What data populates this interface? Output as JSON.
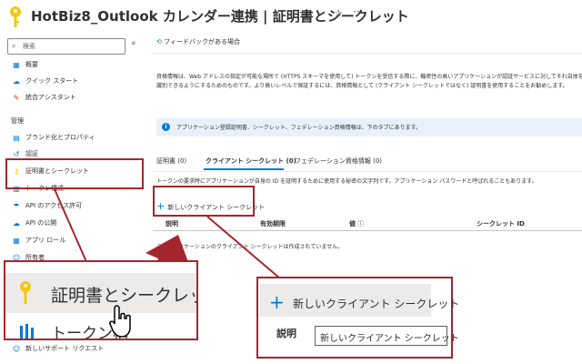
{
  "header": {
    "title": "HotBiz8_Outlook カレンダー連携 | 証明書とシークレット",
    "pin_icon": "✰",
    "more_icon": "···"
  },
  "sidebar": {
    "search_placeholder": "検索",
    "collapse_icon": "«",
    "items": [
      {
        "label": "概要",
        "icon": "▦"
      },
      {
        "label": "クイック スタート",
        "icon": "☁"
      },
      {
        "label": "統合アシスタント",
        "icon": "✎"
      }
    ],
    "section_label": "管理",
    "manage_items": [
      {
        "label": "ブランド化とプロパティ",
        "icon": "▤"
      },
      {
        "label": "認証",
        "icon": "↺"
      },
      {
        "label": "証明書とシークレット",
        "icon": "⚷"
      },
      {
        "label": "トークン構成",
        "icon": "▥"
      },
      {
        "label": "API のアクセス許可",
        "icon": "☂"
      },
      {
        "label": "API の公開",
        "icon": "☁"
      },
      {
        "label": "アプリ ロール",
        "icon": "▦"
      },
      {
        "label": "所有者",
        "icon": "☺"
      }
    ],
    "bottom_item": {
      "label": "新しいサポート リクエスト",
      "icon": "☺"
    }
  },
  "main": {
    "feedback_label": "フィードバックがある場合",
    "description_line1": "資格情報は、Web アドレスの指定が可能な場所で (HTTPS スキーマを使用して) トークンを受信する際に、機密性の高いアプリケーションが認証サービスに対してそれ自体を",
    "description_line2": "識別できるようにするためのものです。より高いレベルで保証するには、資格情報として (クライアント シークレットではなく) 証明書を使用することをお勧めします。",
    "info_text": "アプリケーション登録証明書、シークレット、フェデレーション資格情報は、下のタブにあります。",
    "tabs": [
      {
        "label": "証明書 (0)"
      },
      {
        "label": "クライアント シークレット (0)"
      },
      {
        "label": "フェデレーション資格情報 (0)"
      }
    ],
    "tab_description": "トークンの要求時にアプリケーションが自身の ID を証明するために使用する秘密の文字列です。アプリケーション パスワードと呼ばれることもあります。",
    "new_secret_label": "新しいクライアント シークレット",
    "columns": [
      "説明",
      "有効期限",
      "値",
      "シークレット ID"
    ],
    "empty_text": "このアプリケーションのクライアント シークレットは作成されていません。"
  },
  "zoom_left": {
    "label": "証明書とシークレット",
    "label2": "トークン構"
  },
  "zoom_right": {
    "button_label": "新しいクライアント シークレット",
    "column_label": "説明",
    "tooltip": "新しいクライアント シークレット"
  },
  "colors": {
    "accent": "#0078d4",
    "highlight": "#a4262c",
    "arrow": "#a4262c",
    "key": "#f2c811"
  }
}
